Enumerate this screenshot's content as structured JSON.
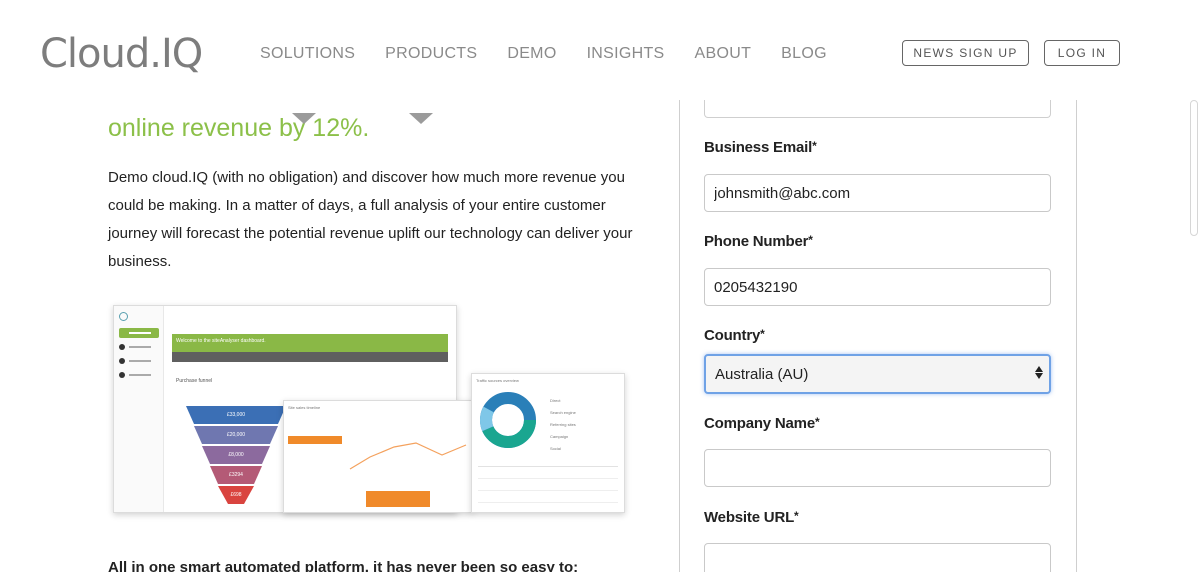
{
  "header": {
    "logo": "Cloud.IQ",
    "nav": [
      "SOLUTIONS",
      "PRODUCTS",
      "DEMO",
      "INSIGHTS",
      "ABOUT",
      "BLOG"
    ],
    "news_signup": "NEWS SIGN UP",
    "login": "LOG IN"
  },
  "hero": {
    "headline": "online revenue by 12%.",
    "intro": "Demo cloud.IQ (with no obligation) and discover how much more revenue you could be making. In a matter of days, a full analysis of your entire customer journey will forecast the potential revenue uplift our technology can deliver your business.",
    "subhead": "All in one smart automated platform, it has never been so easy to:"
  },
  "mockup": {
    "welcome": "Welcome to the siteAnalyser dashboard.",
    "funnel_title": "Purchase funnel",
    "funnel_values": [
      "£33,000",
      "£20,000",
      "£8,000",
      "£3294",
      "£698"
    ],
    "timeline_title": "Site sales timeline",
    "traffic_title": "Traffic sources overview",
    "traffic_legend": [
      "Direct",
      "Search engine",
      "Referring sites",
      "Campaign",
      "Social"
    ]
  },
  "form": {
    "email_label": "Business Email",
    "email_value": "johnsmith@abc.com",
    "phone_label": "Phone Number",
    "phone_value": "0205432190",
    "country_label": "Country",
    "country_value": "Australia (AU)",
    "company_label": "Company Name",
    "company_value": "",
    "website_label": "Website URL",
    "website_value": "",
    "required_mark": "*"
  },
  "colors": {
    "accent_green": "#8cc049",
    "nav_gray": "#8a8a8a",
    "focus_blue": "#6fa2e6"
  }
}
